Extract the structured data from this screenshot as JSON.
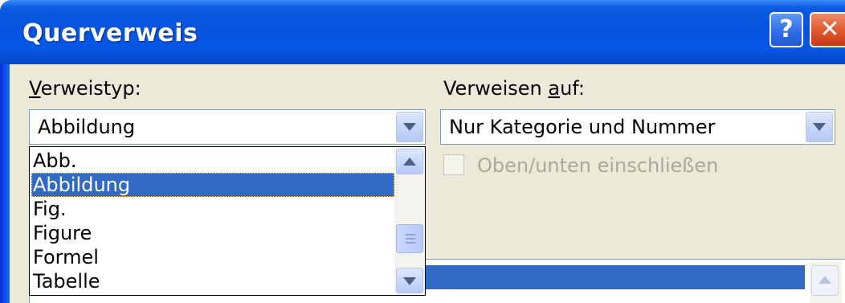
{
  "dialog": {
    "title": "Querverweis",
    "help_button": "?",
    "close_button": "✕"
  },
  "verweistyp": {
    "label_prefix": "V",
    "label_rest": "erweistyp:",
    "selected_value": "Abbildung",
    "options": [
      "Abb.",
      "Abbildung",
      "Fig.",
      "Figure",
      "Formel",
      "Tabelle"
    ],
    "selected_index": 1
  },
  "verweisen_auf": {
    "label_before": "Verweisen ",
    "label_underlined": "a",
    "label_after": "uf:",
    "selected_value": "Nur Kategorie und Nummer"
  },
  "checkbox": {
    "label": "Oben/unten einschließen",
    "checked": false,
    "enabled": false
  },
  "colors": {
    "titlebar": "#0553de",
    "selection": "#316ac5",
    "dialog_bg": "#ece9d8"
  }
}
